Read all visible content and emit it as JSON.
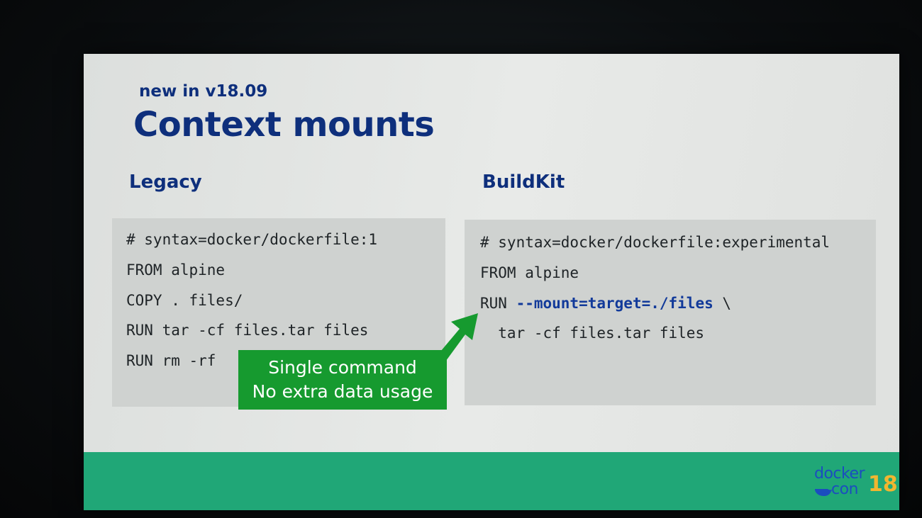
{
  "slide": {
    "subtitle": "new in v18.09",
    "title": "Context mounts"
  },
  "legacy": {
    "heading": "Legacy",
    "lines": [
      "# syntax=docker/dockerfile:1",
      "FROM alpine",
      "COPY . files/",
      "RUN tar -cf files.tar files",
      "RUN rm -rf"
    ]
  },
  "buildkit": {
    "heading": "BuildKit",
    "line1": "# syntax=docker/dockerfile:experimental",
    "line2": "FROM alpine",
    "line3_prefix": "RUN ",
    "line3_flag": "--mount=target=./files",
    "line3_suffix": " \\",
    "line4": "  tar -cf files.tar files"
  },
  "callout": {
    "line1": "Single command",
    "line2": "No extra data usage"
  },
  "logo": {
    "word1": "docker",
    "word2": "con",
    "number": "18"
  },
  "colors": {
    "title": "#0e2f7c",
    "callout": "#169a2f",
    "footer": "#20a777",
    "logo_blue": "#1b4dbf",
    "logo_yellow": "#f1b630"
  },
  "icons": [
    "callout-arrow-icon",
    "docker-whale-icon"
  ]
}
